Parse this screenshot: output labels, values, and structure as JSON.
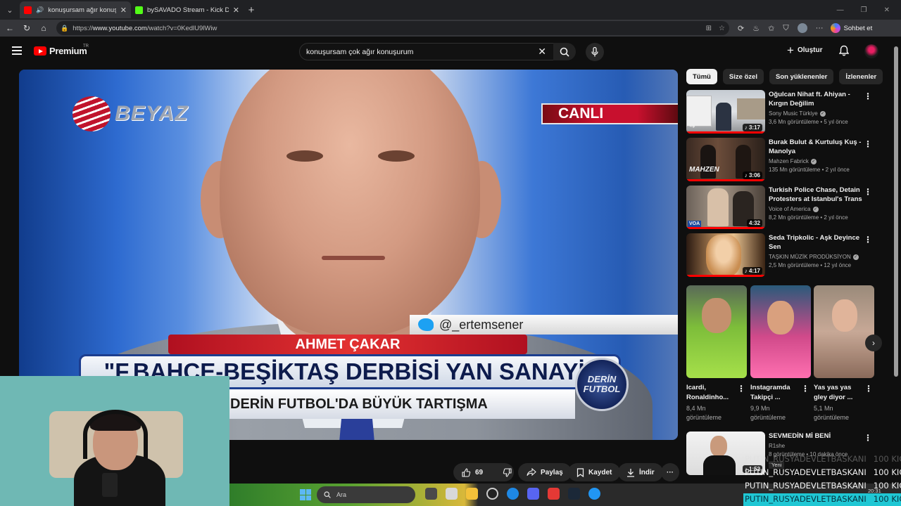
{
  "browser": {
    "tabs": [
      {
        "title": "konuşursam ağır konuşurum",
        "active": true
      },
      {
        "title": "bySAVADO Stream - Kick Dashboard",
        "active": false
      }
    ],
    "url_prefix": "https://",
    "url_host": "www.youtube.com",
    "url_path": "/watch?v=0KedlU9lWiw",
    "copilot_label": "Sohbet et"
  },
  "youtube": {
    "logo_text": "Premium",
    "country_code": "TR",
    "search_query": "konuşursam çok ağır konuşurum",
    "create_label": "Oluştur",
    "brand_color": "#ff0000"
  },
  "video": {
    "channel_logo": "BEYAZ",
    "live_badge": "CANLI",
    "twitter_handle": "@_ertemsener",
    "person_name": "AHMET ÇAKAR",
    "headline": "\"F.BAHÇE-BEŞİKTAŞ DERBİSİ YAN SANAYİ\"",
    "subheadline": "DERİN FUTBOL'DA BÜYÜK TARTIŞMA",
    "show_logo_line1": "DERİN",
    "show_logo_line2": "FUTBOL"
  },
  "actions": {
    "likes": "69",
    "share": "Paylaş",
    "save": "Kaydet",
    "download": "İndir"
  },
  "chips": [
    "Tümü",
    "Size özel",
    "Son yüklenenler",
    "İzlenenler"
  ],
  "recommendations": [
    {
      "title": "Oğulcan Nihat ft. Ahiyan - Kırgın Değilim",
      "channel": "Sony Music Türkiye",
      "verified": true,
      "stats": "3,6 Mn görüntüleme • 5 yıl önce",
      "duration": "3:17",
      "watched": 1.0
    },
    {
      "title": "Burak Bulut & Kurtuluş Kuş - Manolya",
      "channel": "Mahzen Fabrick",
      "verified": true,
      "stats": "135 Mn görüntüleme • 2 yıl önce",
      "duration": "3:06",
      "watched": 1.0
    },
    {
      "title": "Turkish Police Chase, Detain Protesters at Istanbul's Trans ...",
      "channel": "Voice of America",
      "verified": true,
      "stats": "8,2 Mn görüntüleme • 2 yıl önce",
      "duration": "4:32",
      "watched": 1.0
    },
    {
      "title": "Seda Tripkolic  - Aşk Deyince Sen",
      "channel": "TAŞKIN MÜZİK PRODÜKSİYON",
      "verified": true,
      "stats": "2,5 Mn görüntüleme • 12 yıl önce",
      "duration": "4:17",
      "watched": 1.0
    }
  ],
  "thumb_labels": {
    "mahzen": "MAHZEN",
    "voa": "VOA"
  },
  "shorts": [
    {
      "title": "Icardi, Ronaldinho...",
      "views_line1": "8,4 Mn",
      "views_line2": "görüntüleme"
    },
    {
      "title": "Instagramda Takipçi ...",
      "views_line1": "9,9 Mn",
      "views_line2": "görüntüleme"
    },
    {
      "title": "Yas yas yas gley diyor ...",
      "views_line1": "5,1 Mn",
      "views_line2": "görüntüleme"
    }
  ],
  "last_recommendation": {
    "title": "SEVMEDİN Mİ BENİ",
    "channel": "R1she",
    "stats": "8 görüntüleme • 10 dakika önce",
    "duration": "1:52",
    "badge": "Yeni"
  },
  "taskbar": {
    "search_placeholder": "Ara",
    "clock": "20:31"
  },
  "kicks_overlay": [
    {
      "user": "PUTIN_RUSYADEVLETBASKANI",
      "amount": "100 KICKS"
    },
    {
      "user": "PUTIN_RUSYADEVLETBASKANI",
      "amount": "100 KICKS"
    },
    {
      "user": "PUTIN_RUSYADEVLETBASKANI",
      "amount": "100 KICKS"
    },
    {
      "user": "PUTIN_RUSYADEVLETBASKANI",
      "amount": "100 KICKS"
    }
  ]
}
